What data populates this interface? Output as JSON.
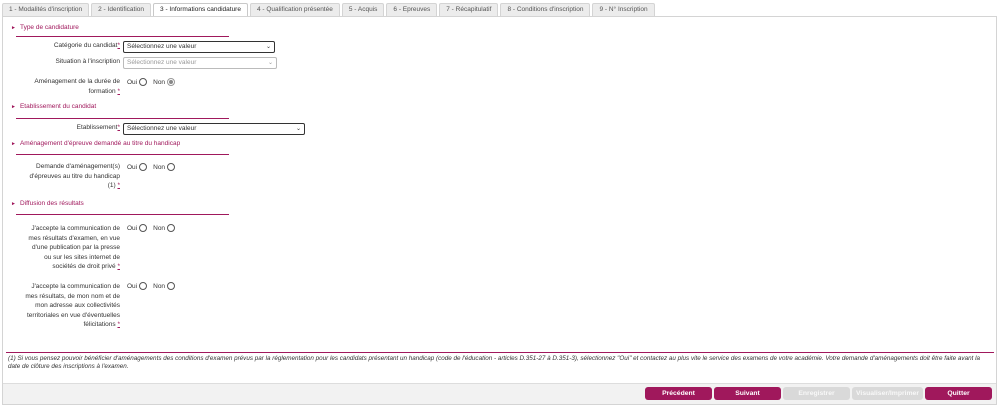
{
  "tabs": [
    {
      "label": "1 - Modalités d'inscription",
      "active": false
    },
    {
      "label": "2 - Identification",
      "active": false
    },
    {
      "label": "3 - Informations candidature",
      "active": true
    },
    {
      "label": "4 - Qualification présentée",
      "active": false
    },
    {
      "label": "5 - Acquis",
      "active": false
    },
    {
      "label": "6 - Epreuves",
      "active": false
    },
    {
      "label": "7 - Récapitulatif",
      "active": false
    },
    {
      "label": "8 - Conditions d'inscription",
      "active": false
    },
    {
      "label": "9 - N° Inscription",
      "active": false
    }
  ],
  "sections": {
    "type": "Type de candidature",
    "etablissement": "Etablissement du candidat",
    "handicap": "Aménagement d'épreuve demandé au titre du handicap",
    "diffusion": "Diffusion des résultats"
  },
  "fields": {
    "categorie_label": "Catégorie du candidat",
    "categorie_value": "Sélectionnez une valeur",
    "situation_label": "Situation à l'inscription",
    "situation_value": "Sélectionnez une valeur",
    "amenagement_duree_label_1": "Aménagement de la durée de",
    "amenagement_duree_label_2": "formation",
    "etablissement_label": "Etablissement",
    "etablissement_value": "Sélectionnez une valeur",
    "demande_label_1": "Demande d'aménagement(s)",
    "demande_label_2": "d'épreuves au titre du handicap",
    "demande_label_3": "(1)",
    "accepte1_lines": [
      "J'accepte la communication de",
      "mes résultats d'examen, en vue",
      "d'une publication par la presse",
      "ou sur les sites internet de",
      "sociétés de droit privé"
    ],
    "accepte2_lines": [
      "J'accepte la communication de",
      "mes résultats, de mon nom et de",
      "mon adresse aux collectivités",
      "territoriales en vue d'éventuelles",
      "félicitations"
    ],
    "required_mark": "*",
    "oui": "Oui",
    "non": "Non"
  },
  "footnote": "(1) Si vous pensez pouvoir bénéficier d'aménagements des conditions d'examen prévus par la réglementation pour les candidats présentant un handicap (code de l'éducation - articles D.351-27 à D.351-3), sélectionnez \"Oui\" et contactez au plus vite le service des examens de votre académie. Votre demande d'aménagements doit être faite avant la date de clôture des inscriptions à l'examen.",
  "buttons": {
    "precedent": "Précédent",
    "suivant": "Suivant",
    "enregistrer": "Enregistrer",
    "visualiser": "Visualiser/Imprimer",
    "quitter": "Quitter"
  },
  "colors": {
    "accent": "#a0185c",
    "disabled": "#d9d9d9"
  }
}
